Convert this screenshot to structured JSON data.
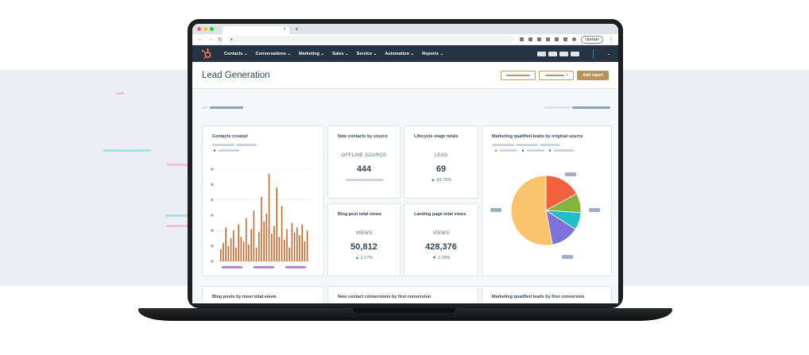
{
  "browser": {
    "update_label": "Update",
    "new_tab": "+",
    "close_tab": "×"
  },
  "nav": {
    "items": [
      "Contacts",
      "Conversations",
      "Marketing",
      "Sales",
      "Service",
      "Automation",
      "Reports"
    ]
  },
  "header": {
    "title": "Lead Generation",
    "add_report_label": "Add report"
  },
  "cards": {
    "contacts_created": {
      "title": "Contacts created"
    },
    "new_contacts": {
      "title": "New contacts by source",
      "label": "OFFLINE SOURCE",
      "value": "444"
    },
    "lifecycle": {
      "title": "Lifecycle stage totals",
      "label": "LEAD",
      "value": "69",
      "delta": "43.75%"
    },
    "mql_source": {
      "title": "Marketing qualified leads by original source"
    },
    "blog_views": {
      "title": "Blog post total views",
      "label": "VIEWS",
      "value": "50,812",
      "delta": "1.17%"
    },
    "landing_views": {
      "title": "Landing page total views",
      "label": "VIEWS",
      "value": "428,376",
      "delta": "2.78%"
    },
    "blog_most": {
      "title": "Blog posts by most total views"
    },
    "conversions": {
      "title": "New contact conversions by first conversion"
    },
    "mql_first": {
      "title": "Marketing qualified leads by first conversion"
    }
  },
  "colors": {
    "nav_bg": "#253342",
    "accent": "#b8935a",
    "bar": "#c46a2e"
  },
  "chart_data": [
    {
      "type": "bar",
      "title": "Contacts created",
      "values": [
        8,
        12,
        22,
        10,
        15,
        20,
        9,
        24,
        16,
        13,
        28,
        11,
        21,
        33,
        9,
        19,
        42,
        26,
        31,
        57,
        18,
        23,
        48,
        16,
        36,
        14,
        21,
        9,
        25,
        19,
        22,
        17,
        24,
        13,
        20
      ]
    },
    {
      "type": "pie",
      "title": "Marketing qualified leads by original source",
      "values": [
        17,
        9,
        8,
        13,
        53
      ],
      "colors": [
        "#f2613b",
        "#85b33d",
        "#20bfc7",
        "#7c72d9",
        "#f9c46b"
      ]
    }
  ]
}
